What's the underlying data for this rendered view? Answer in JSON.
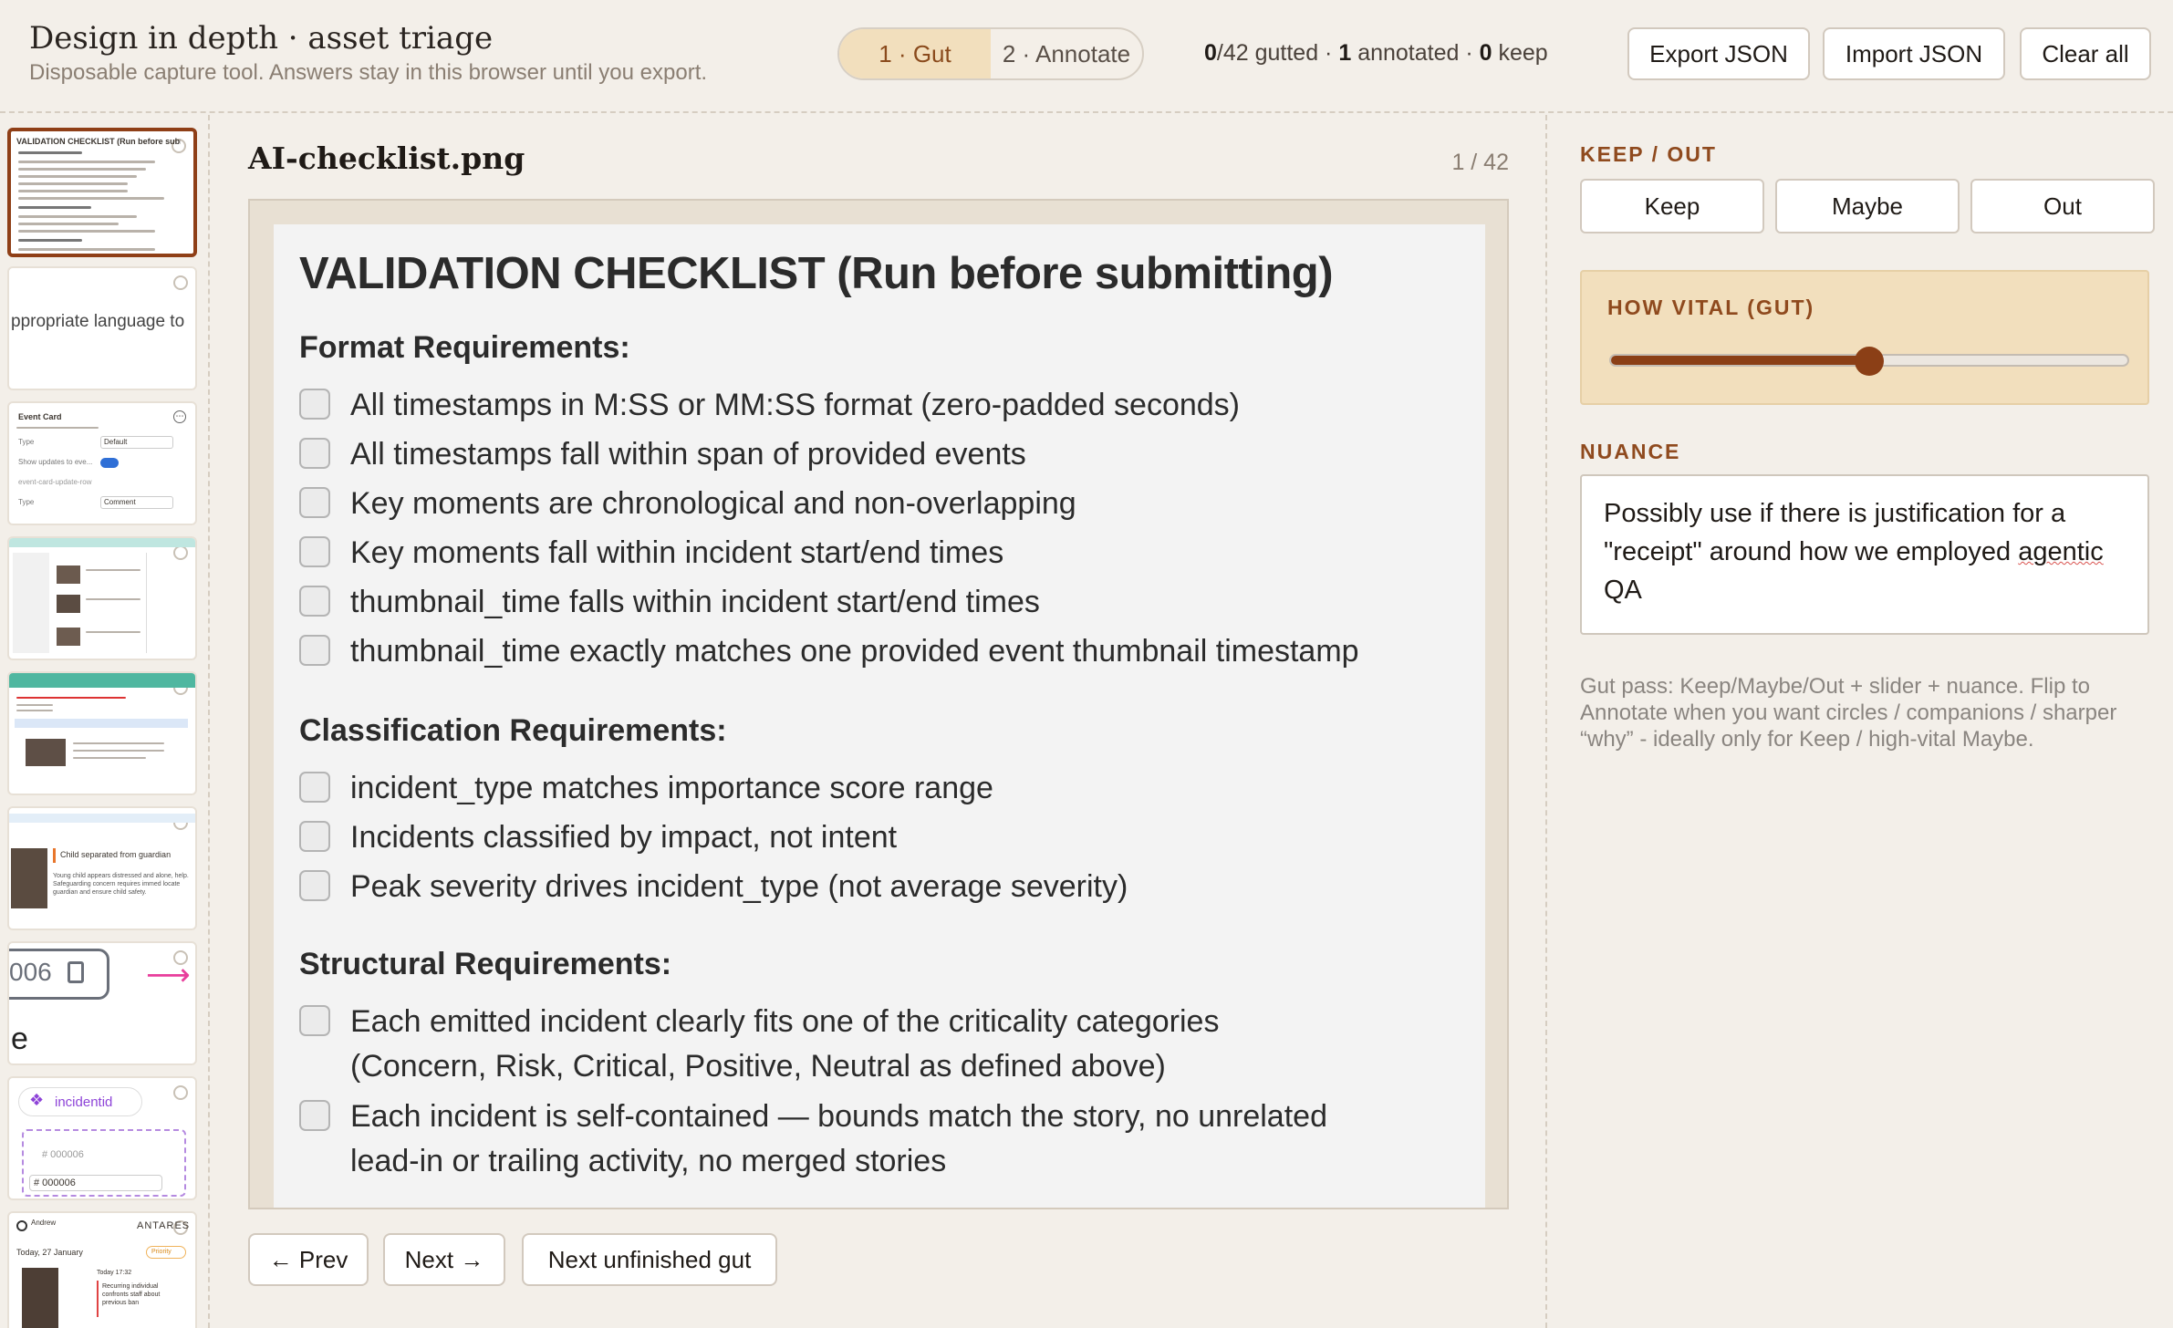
{
  "header": {
    "title": "Design in depth · asset triage",
    "subtitle": "Disposable capture tool. Answers stay in this browser until you export.",
    "modes": [
      {
        "label": "1 · Gut",
        "active": true
      },
      {
        "label": "2 · Annotate",
        "active": false
      }
    ],
    "stats": {
      "gutted": "0",
      "gutted_suffix": "/42 gutted · ",
      "annotated": "1",
      "annotated_suffix": " annotated · ",
      "keep": "0",
      "keep_suffix": " keep"
    },
    "buttons": {
      "export": "Export JSON",
      "import": "Import JSON",
      "clear": "Clear all"
    }
  },
  "sidebar": {
    "thumbnails": [
      {
        "title": "VALIDATION CHECKLIST (Run before submitting)",
        "active": true
      },
      {
        "text": "ppropriate language to"
      },
      {
        "title": "Event Card",
        "field1": "Type",
        "value1": "Default",
        "field2": "Show updates to eve...",
        "field3": "event-card-update-row",
        "field4": "Type",
        "value4": "Comment"
      },
      {
        "kind": "dashboard"
      },
      {
        "kind": "report"
      },
      {
        "title": "Child separated from guardian",
        "body": "Young child appears distressed and alone, help. Safeguarding concern requires immed locate guardian and ensure child safety."
      },
      {
        "code": "006",
        "letter": "e"
      },
      {
        "brand": "incidentid",
        "id1": "# 000006",
        "id2": "# 000006"
      },
      {
        "user": "Andrew",
        "brand": "ANTARES",
        "date": "Today, 27 January",
        "badge": "Priority",
        "time": "Today 17:32",
        "body": "Recurring individual confronts staff about previous ban"
      }
    ]
  },
  "main": {
    "filename": "AI-checklist.png",
    "counter": "1 / 42",
    "document": {
      "title": "VALIDATION CHECKLIST (Run before submitting)",
      "sections": [
        {
          "heading": "Format Requirements:",
          "items": [
            "All timestamps in M:SS or MM:SS format (zero-padded seconds)",
            "All timestamps fall within span of provided events",
            "Key moments are chronological and non-overlapping",
            "Key moments fall within incident start/end times",
            "thumbnail_time falls within incident start/end times",
            "thumbnail_time exactly matches one provided event thumbnail timestamp"
          ]
        },
        {
          "heading": "Classification Requirements:",
          "items": [
            "incident_type matches importance score range",
            "Incidents classified by impact, not intent",
            "Peak severity drives incident_type (not average severity)"
          ]
        },
        {
          "heading": "Structural Requirements:",
          "items": [
            {
              "line1": "Each emitted incident clearly fits one of the criticality categories",
              "line2": "(Concern, Risk, Critical, Positive, Neutral as defined above)"
            },
            {
              "line1": "Each incident is self-contained — bounds match the story, no unrelated",
              "line2": "lead-in or trailing activity, no merged stories"
            }
          ]
        }
      ]
    },
    "nav": {
      "prev": "← Prev",
      "next": "Next →",
      "next_unfinished": "Next unfinished gut"
    }
  },
  "panel": {
    "keep_out_label": "KEEP / OUT",
    "keep_options": [
      "Keep",
      "Maybe",
      "Out"
    ],
    "vital_label": "HOW VITAL (GUT)",
    "vital_value": 0.5,
    "nuance_label": "NUANCE",
    "nuance_text_before": "Possibly use if there is justification for a \"receipt\" around how we employed ",
    "nuance_text_flagged": "agentic",
    "nuance_text_after": " QA",
    "help_text": "Gut pass: Keep/Maybe/Out + slider + nuance. Flip to Annotate when you want circles / companions / sharper “why” - ideally only for Keep / high-vital Maybe."
  },
  "colors": {
    "accent": "#8b3f16",
    "accent_soft": "#f2dfbd",
    "background": "#f3efe9"
  }
}
